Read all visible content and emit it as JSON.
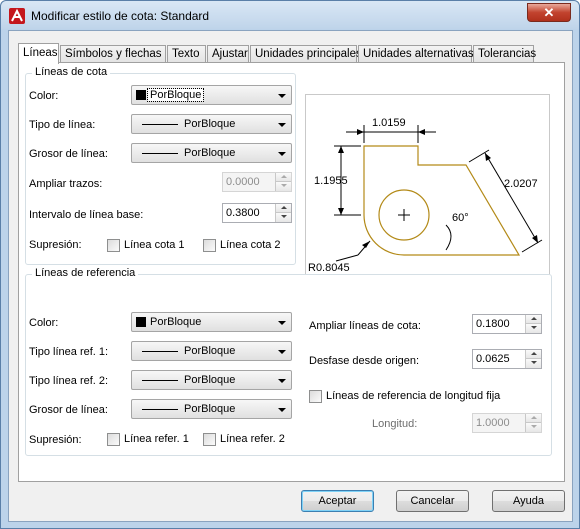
{
  "window": {
    "title": "Modificar estilo de cota: Standard",
    "close_label": "✕"
  },
  "tabs": [
    {
      "label": "Líneas",
      "active": true
    },
    {
      "label": "Símbolos y flechas"
    },
    {
      "label": "Texto"
    },
    {
      "label": "Ajustar"
    },
    {
      "label": "Unidades principales"
    },
    {
      "label": "Unidades alternativas"
    },
    {
      "label": "Tolerancias"
    }
  ],
  "dim_lines": {
    "group_title": "Líneas de cota",
    "color_label": "Color:",
    "color_value": "PorBloque",
    "linetype_label": "Tipo de línea:",
    "linetype_value": "PorBloque",
    "lineweight_label": "Grosor de línea:",
    "lineweight_value": "PorBloque",
    "extend_ticks_label": "Ampliar trazos:",
    "extend_ticks_value": "0.0000",
    "baseline_spacing_label": "Intervalo de línea base:",
    "baseline_spacing_value": "0.3800",
    "suppress_label": "Supresión:",
    "suppress_1": "Línea cota 1",
    "suppress_2": "Línea cota 2"
  },
  "ext_lines": {
    "group_title": "Líneas de referencia",
    "color_label": "Color:",
    "color_value": "PorBloque",
    "linetype1_label": "Tipo línea ref. 1:",
    "linetype1_value": "PorBloque",
    "linetype2_label": "Tipo línea ref. 2:",
    "linetype2_value": "PorBloque",
    "lineweight_label": "Grosor de línea:",
    "lineweight_value": "PorBloque",
    "suppress_label": "Supresión:",
    "suppress_1": "Línea refer. 1",
    "suppress_2": "Línea refer. 2",
    "extend_label": "Ampliar líneas de cota:",
    "extend_value": "0.1800",
    "offset_label": "Desfase desde origen:",
    "offset_value": "0.0625",
    "fixed_length_label": "Líneas de referencia de longitud fija",
    "length_label": "Longitud:",
    "length_value": "1.0000"
  },
  "preview": {
    "dim_top": "1.0159",
    "dim_left": "1.1955",
    "dim_right": "2.0207",
    "dim_angle": "60°",
    "dim_radius": "R0.8045"
  },
  "buttons": {
    "ok": "Aceptar",
    "cancel": "Cancelar",
    "help": "Ayuda"
  },
  "colors": {
    "geometry": "#b38a18",
    "titlebar": "#bfd4ea",
    "close": "#c2432e"
  }
}
